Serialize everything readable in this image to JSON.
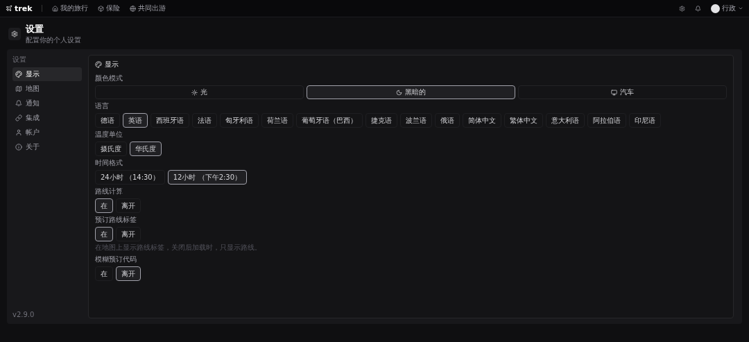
{
  "topbar": {
    "brand": "trek",
    "nav": [
      {
        "label": "我的旅行"
      },
      {
        "label": "保险"
      },
      {
        "label": "共同出游"
      }
    ],
    "user": "行政"
  },
  "header": {
    "title": "设置",
    "subtitle": "配置你的个人设置"
  },
  "sidebar": {
    "heading": "设置",
    "items": [
      {
        "label": "显示",
        "selected": true
      },
      {
        "label": "地图",
        "selected": false
      },
      {
        "label": "通知",
        "selected": false
      },
      {
        "label": "集成",
        "selected": false
      },
      {
        "label": "帐户",
        "selected": false
      },
      {
        "label": "关于",
        "selected": false
      }
    ],
    "version": "v2.9.0"
  },
  "card": {
    "title": "显示",
    "color_mode": {
      "label": "颜色模式",
      "options": [
        {
          "label": "光",
          "selected": false
        },
        {
          "label": "黑暗的",
          "selected": true
        },
        {
          "label": "汽车",
          "selected": false
        }
      ]
    },
    "groups": [
      {
        "label": "语言",
        "options": [
          {
            "label": "德语",
            "selected": false
          },
          {
            "label": "英语",
            "selected": true
          },
          {
            "label": "西班牙语",
            "selected": false
          },
          {
            "label": "法语",
            "selected": false
          },
          {
            "label": "匈牙利语",
            "selected": false
          },
          {
            "label": "荷兰语",
            "selected": false
          },
          {
            "label": "葡萄牙语（巴西）",
            "selected": false
          },
          {
            "label": "捷克语",
            "selected": false
          },
          {
            "label": "波兰语",
            "selected": false
          },
          {
            "label": "俄语",
            "selected": false
          },
          {
            "label": "简体中文",
            "selected": false
          },
          {
            "label": "繁体中文",
            "selected": false
          },
          {
            "label": "意大利语",
            "selected": false
          },
          {
            "label": "阿拉伯语",
            "selected": false
          },
          {
            "label": "印尼语",
            "selected": false
          }
        ]
      },
      {
        "label": "温度单位",
        "options": [
          {
            "label": "摄氏度",
            "selected": false
          },
          {
            "label": "华氏度",
            "selected": true
          }
        ]
      },
      {
        "label": "时间格式",
        "options": [
          {
            "label": "24小时 （14:30）",
            "selected": false
          },
          {
            "label": "12小时 （下午2:30）",
            "selected": true
          }
        ]
      },
      {
        "label": "路线计算",
        "options": [
          {
            "label": "在",
            "selected": true
          },
          {
            "label": "离开",
            "selected": false
          }
        ]
      },
      {
        "label": "预订路线标签",
        "options": [
          {
            "label": "在",
            "selected": true
          },
          {
            "label": "离开",
            "selected": false
          }
        ],
        "hint": "在地图上显示路线标签，关闭后加载时，只显示路线。"
      },
      {
        "label": "模糊预订代码",
        "options": [
          {
            "label": "在",
            "selected": false
          },
          {
            "label": "离开",
            "selected": true
          }
        ]
      }
    ]
  }
}
